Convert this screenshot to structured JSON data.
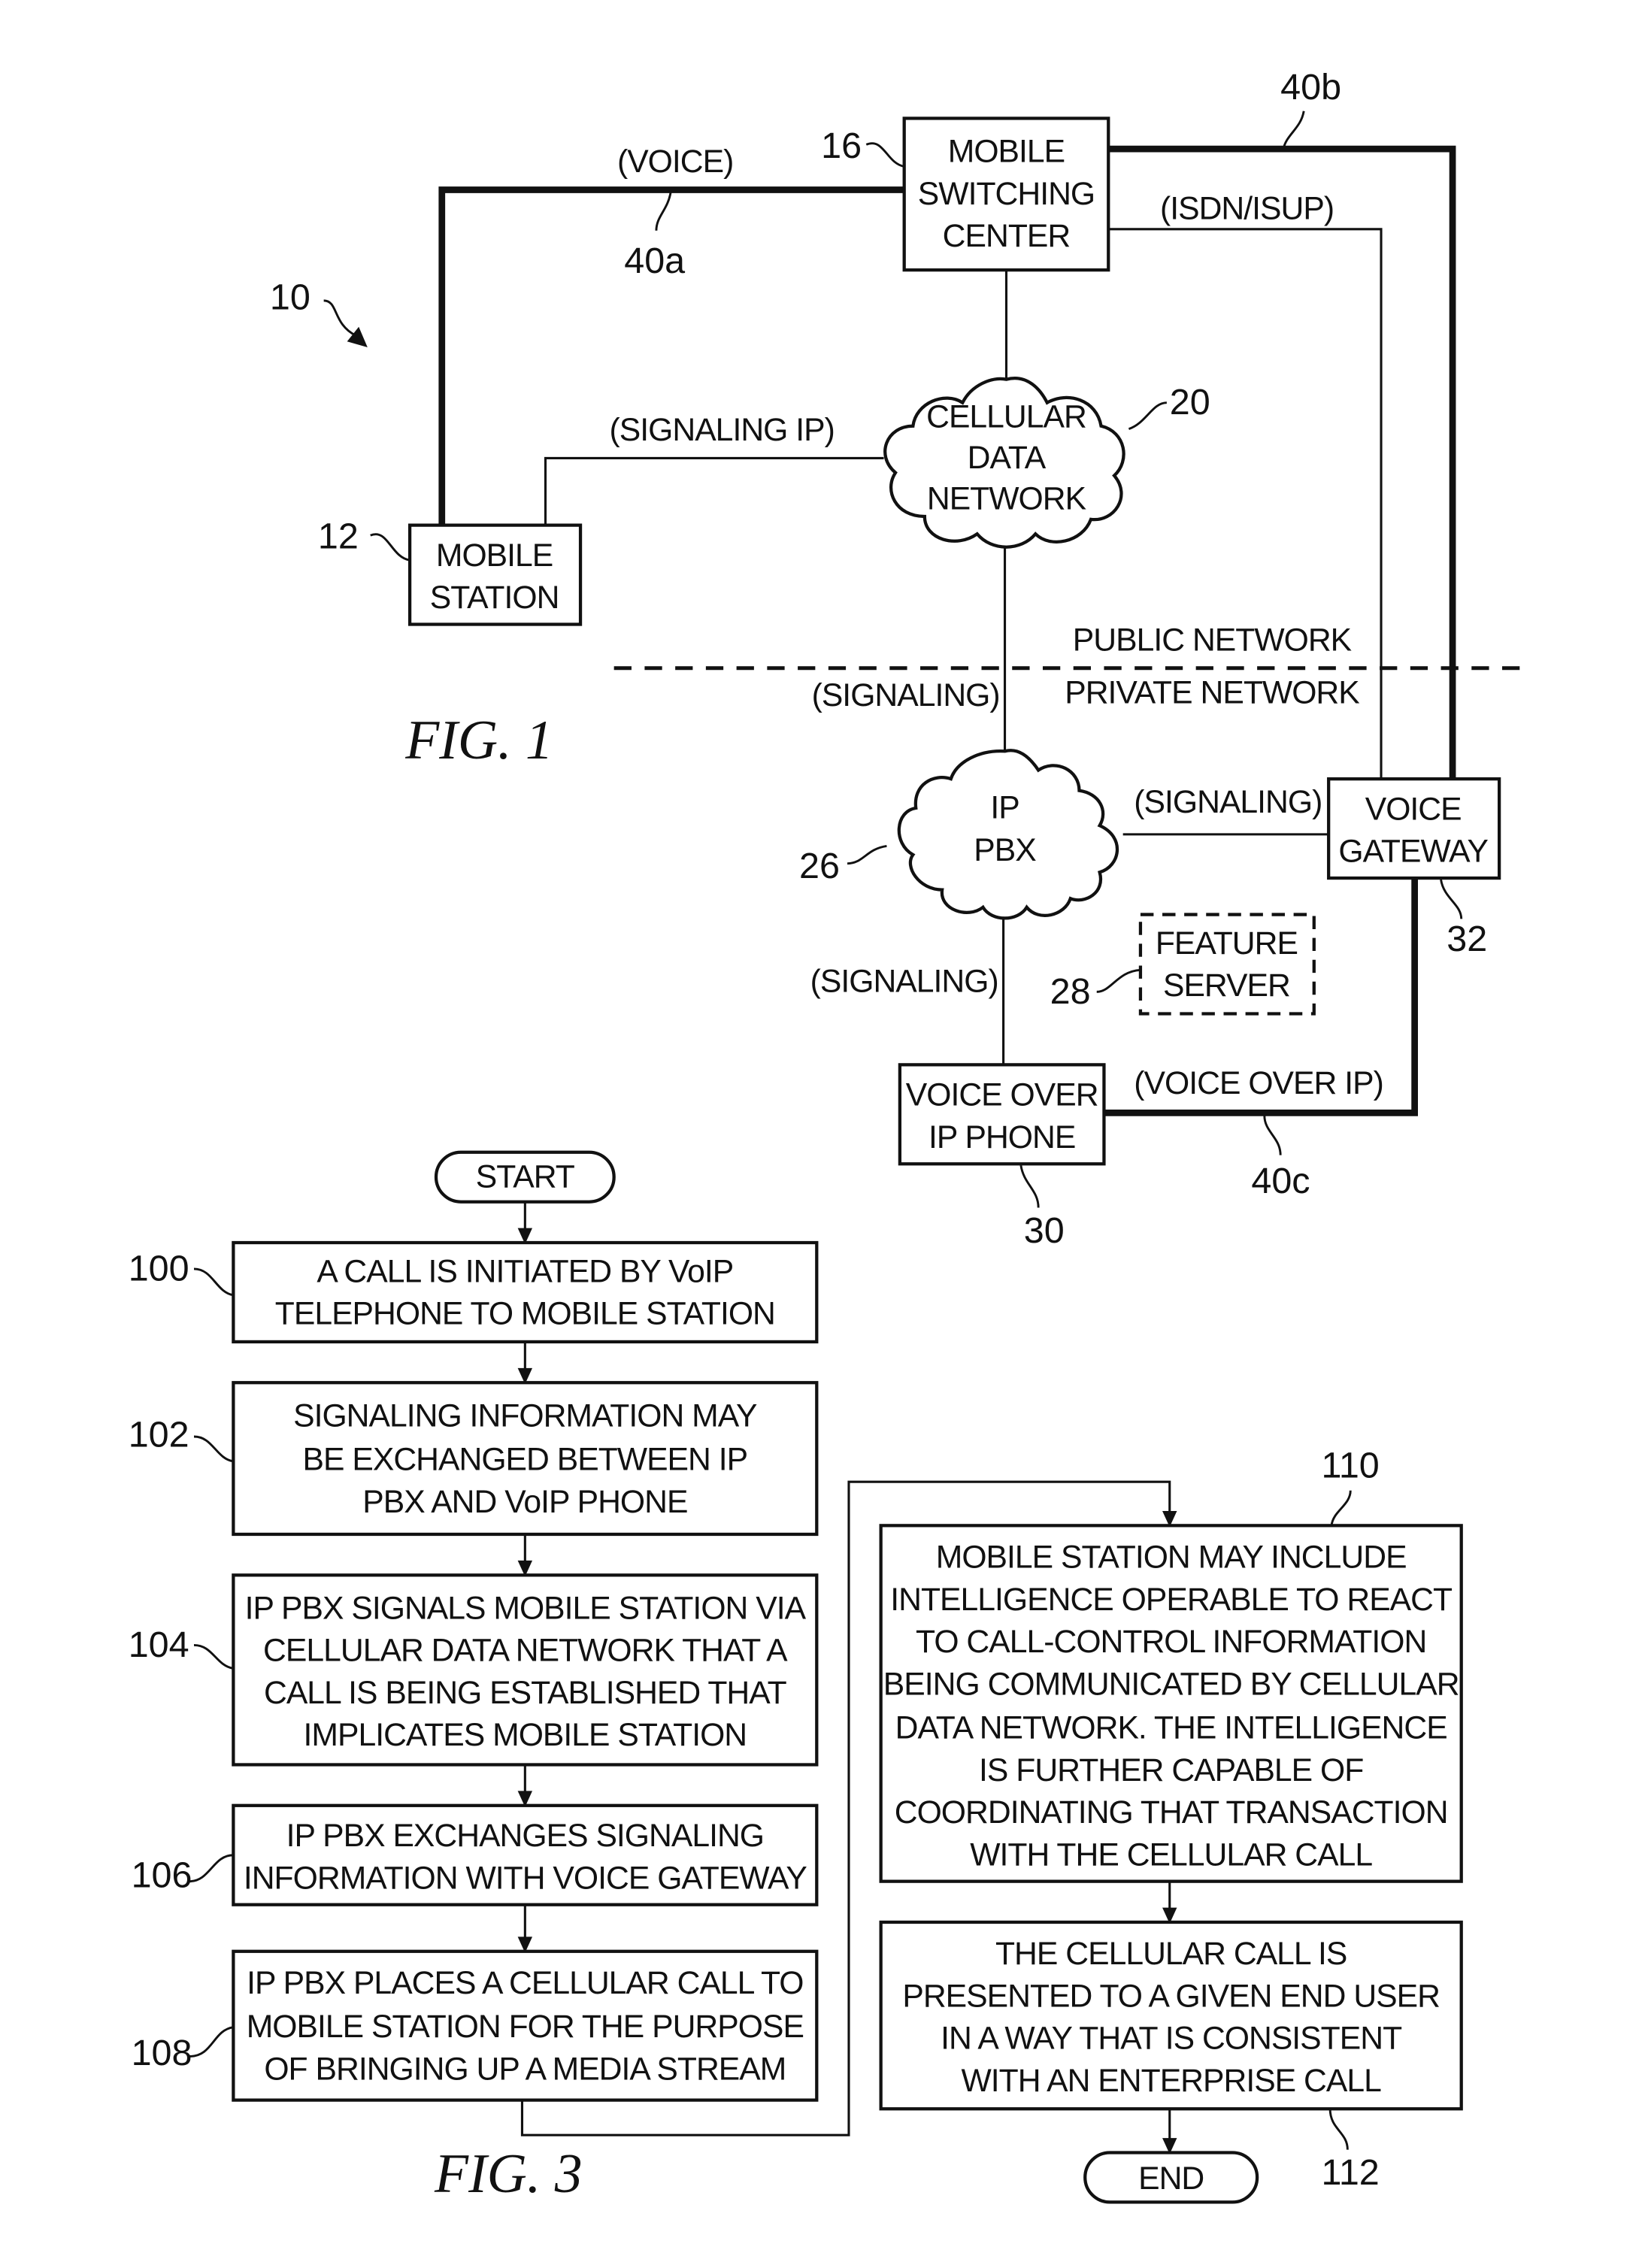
{
  "fig1": {
    "caption": "FIG. 1",
    "system_ref": "10",
    "mobile_station": {
      "ref": "12",
      "lines": [
        "MOBILE",
        "STATION"
      ]
    },
    "msc": {
      "ref": "16",
      "lines": [
        "MOBILE",
        "SWITCHING",
        "CENTER"
      ]
    },
    "cellular_data_network": {
      "ref": "20",
      "lines": [
        "CELLULAR",
        "DATA",
        "NETWORK"
      ]
    },
    "ip_pbx": {
      "ref": "26",
      "lines": [
        "IP",
        "PBX"
      ]
    },
    "feature_server": {
      "ref": "28",
      "lines": [
        "FEATURE",
        "SERVER"
      ]
    },
    "voip_phone": {
      "ref": "30",
      "lines": [
        "VOICE OVER",
        "IP PHONE"
      ]
    },
    "voice_gateway": {
      "ref": "32",
      "lines": [
        "VOICE",
        "GATEWAY"
      ]
    },
    "links": {
      "voice": {
        "label": "(VOICE)",
        "ref": "40a"
      },
      "msc_gateway_voice": {
        "ref": "40b"
      },
      "isdn": {
        "label": "(ISDN/ISUP)"
      },
      "signaling_ip": {
        "label": "(SIGNALING IP)"
      },
      "signaling_cdn_pbx": {
        "label": "(SIGNALING)"
      },
      "signaling_pbx_gateway": {
        "label": "(SIGNALING)"
      },
      "signaling_pbx_phone": {
        "label": "(SIGNALING)"
      },
      "voip": {
        "label": "(VOICE OVER IP)",
        "ref": "40c"
      }
    },
    "boundary": {
      "public": "PUBLIC NETWORK",
      "private": "PRIVATE NETWORK"
    }
  },
  "fig3": {
    "caption": "FIG. 3",
    "start": "START",
    "end": "END",
    "steps": [
      {
        "ref": "100",
        "lines": [
          "A CALL IS INITIATED BY VoIP",
          "TELEPHONE TO MOBILE STATION"
        ]
      },
      {
        "ref": "102",
        "lines": [
          "SIGNALING INFORMATION MAY",
          "BE EXCHANGED BETWEEN IP",
          "PBX AND VoIP PHONE"
        ]
      },
      {
        "ref": "104",
        "lines": [
          "IP PBX SIGNALS MOBILE STATION VIA",
          "CELLULAR DATA NETWORK THAT A",
          "CALL IS BEING ESTABLISHED THAT",
          "IMPLICATES MOBILE STATION"
        ]
      },
      {
        "ref": "106",
        "lines": [
          "IP PBX EXCHANGES SIGNALING",
          "INFORMATION WITH VOICE GATEWAY"
        ]
      },
      {
        "ref": "108",
        "lines": [
          "IP PBX PLACES A CELLULAR CALL TO",
          "MOBILE STATION FOR THE PURPOSE",
          "OF BRINGING UP A MEDIA STREAM"
        ]
      },
      {
        "ref": "110",
        "lines": [
          "MOBILE STATION MAY INCLUDE",
          "INTELLIGENCE OPERABLE TO REACT",
          "TO CALL-CONTROL INFORMATION",
          "BEING COMMUNICATED BY CELLULAR",
          "DATA NETWORK. THE INTELLIGENCE",
          "IS FURTHER CAPABLE OF",
          "COORDINATING THAT TRANSACTION",
          "WITH THE CELLULAR CALL"
        ]
      },
      {
        "ref": "112",
        "lines": [
          "THE CELLULAR CALL IS",
          "PRESENTED TO A GIVEN END USER",
          "IN A WAY THAT IS CONSISTENT",
          "WITH AN ENTERPRISE CALL"
        ]
      }
    ]
  }
}
